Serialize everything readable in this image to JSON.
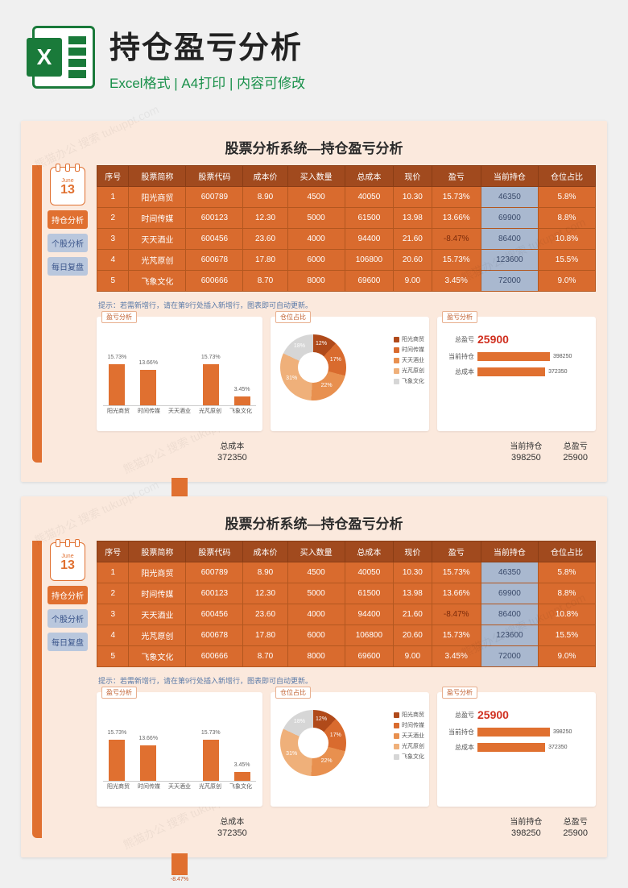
{
  "hero": {
    "title": "持仓盈亏分析",
    "subtitle": "Excel格式 | A4打印 | 内容可修改",
    "icon_letter": "X"
  },
  "watermark": "熊猫办公 搜索 tukuppt.com",
  "calendar": {
    "month": "June",
    "day": "13"
  },
  "nav": [
    {
      "label": "持仓分析",
      "active": true
    },
    {
      "label": "个股分析",
      "active": false
    },
    {
      "label": "每日复盘",
      "active": false
    }
  ],
  "sheet_title": "股票分析系统—持仓盈亏分析",
  "columns": [
    "序号",
    "股票简称",
    "股票代码",
    "成本价",
    "买入数量",
    "总成本",
    "现价",
    "盈亏",
    "当前持仓",
    "仓位占比"
  ],
  "rows": [
    {
      "n": "1",
      "name": "阳光商贸",
      "code": "600789",
      "cost": "8.90",
      "qty": "4500",
      "total": "40050",
      "price": "10.30",
      "pl": "15.73%",
      "pl_neg": false,
      "hold": "46350",
      "pct": "5.8%"
    },
    {
      "n": "2",
      "name": "时间传媒",
      "code": "600123",
      "cost": "12.30",
      "qty": "5000",
      "total": "61500",
      "price": "13.98",
      "pl": "13.66%",
      "pl_neg": false,
      "hold": "69900",
      "pct": "8.8%"
    },
    {
      "n": "3",
      "name": "天天酒业",
      "code": "600456",
      "cost": "23.60",
      "qty": "4000",
      "total": "94400",
      "price": "21.60",
      "pl": "-8.47%",
      "pl_neg": true,
      "hold": "86400",
      "pct": "10.8%"
    },
    {
      "n": "4",
      "name": "光芃原创",
      "code": "600678",
      "cost": "17.80",
      "qty": "6000",
      "total": "106800",
      "price": "20.60",
      "pl": "15.73%",
      "pl_neg": false,
      "hold": "123600",
      "pct": "15.5%"
    },
    {
      "n": "5",
      "name": "飞象文化",
      "code": "600666",
      "cost": "8.70",
      "qty": "8000",
      "total": "69600",
      "price": "9.00",
      "pl": "3.45%",
      "pl_neg": false,
      "hold": "72000",
      "pct": "9.0%"
    }
  ],
  "tip": "提示：若需新增行，请在第9行处插入新增行，图表即可自动更新。",
  "chart_data": [
    {
      "type": "bar",
      "title": "盈亏分析",
      "categories": [
        "阳光商贸",
        "时间传媒",
        "天天酒业",
        "光芃原创",
        "飞象文化"
      ],
      "values": [
        15.73,
        13.66,
        -8.47,
        15.73,
        3.45
      ],
      "ylabel": "",
      "ylim": [
        -10,
        18
      ]
    },
    {
      "type": "pie",
      "title": "仓位占比",
      "series": [
        {
          "name": "阳光商贸",
          "value": 12,
          "color": "#b04a1a"
        },
        {
          "name": "时间传媒",
          "value": 17,
          "color": "#d96b2e"
        },
        {
          "name": "天天酒业",
          "value": 22,
          "color": "#e8904f"
        },
        {
          "name": "光芃原创",
          "value": 31,
          "color": "#efb07a"
        },
        {
          "name": "飞象文化",
          "value": 18,
          "color": "#d6d6d6"
        }
      ]
    },
    {
      "type": "bar",
      "title": "盈亏分析",
      "orientation": "h",
      "categories": [
        "总盈亏",
        "当前持仓",
        "总成本"
      ],
      "values": [
        25900,
        398250,
        372350
      ],
      "highlight": {
        "label": "总盈亏",
        "value": "25900"
      }
    }
  ],
  "totals": [
    {
      "label": "总成本",
      "value": "372350"
    },
    {
      "label": "当前持仓",
      "value": "398250"
    },
    {
      "label": "总盈亏",
      "value": "25900"
    }
  ]
}
